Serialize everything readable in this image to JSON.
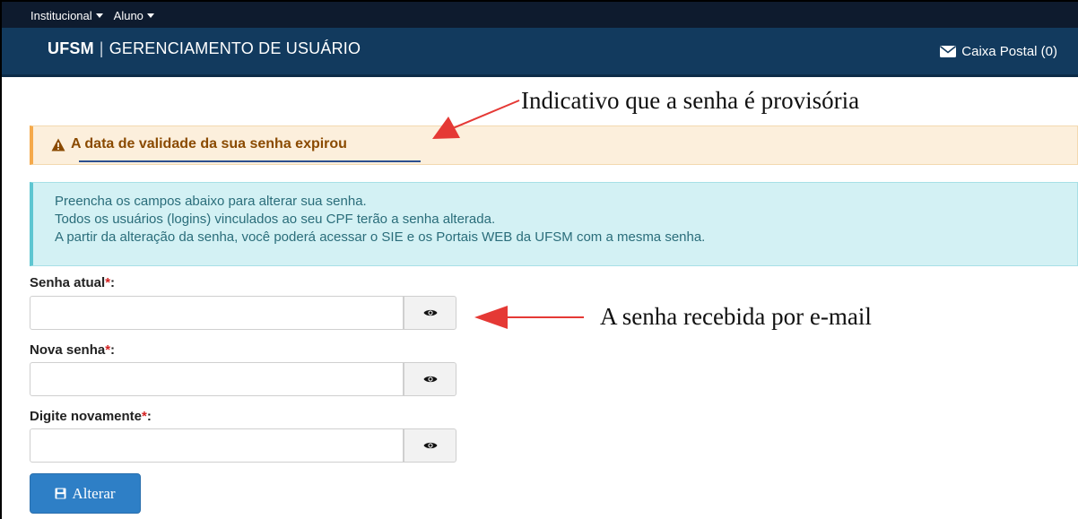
{
  "topnav": {
    "items": [
      {
        "label": "Institucional"
      },
      {
        "label": "Aluno"
      }
    ]
  },
  "header": {
    "brand_short": "UFSM",
    "brand_separator": "|",
    "title": "GERENCIAMENTO DE USUÁRIO",
    "mailbox_label": "Caixa Postal (0)",
    "mailbox_icon": "envelope-icon"
  },
  "alerts": {
    "warning": {
      "icon": "warning-triangle-icon",
      "text": "A data de validade da sua senha expirou"
    },
    "info": {
      "lines": [
        "Preencha os campos abaixo para alterar sua senha.",
        "Todos os usuários (logins) vinculados ao seu CPF terão a senha alterada.",
        "A partir da alteração da senha, você poderá acessar o SIE e os Portais WEB da UFSM com a mesma senha."
      ]
    }
  },
  "form": {
    "required_marker": "*",
    "fields": [
      {
        "label": "Senha atual",
        "suffix": ":",
        "value": "",
        "toggle_icon": "eye-icon"
      },
      {
        "label": "Nova senha",
        "suffix": ":",
        "value": "",
        "toggle_icon": "eye-icon"
      },
      {
        "label": "Digite novamente",
        "suffix": ":",
        "value": "",
        "toggle_icon": "eye-icon"
      }
    ],
    "submit_label": "Alterar",
    "submit_icon": "floppy-disk-icon"
  },
  "annotations": {
    "provisional": "Indicativo que a senha é provisória",
    "email_password": "A senha recebida por e-mail"
  },
  "colors": {
    "topbar": "#0e1b2e",
    "header": "#123a5e",
    "warning_bg": "#fcefdc",
    "warning_border": "#f5a94a",
    "info_bg": "#d3f1f4",
    "info_border": "#5ec6d1",
    "primary_button": "#2e7fc6",
    "required": "#d32222",
    "annotation_arrow": "#e53935"
  }
}
